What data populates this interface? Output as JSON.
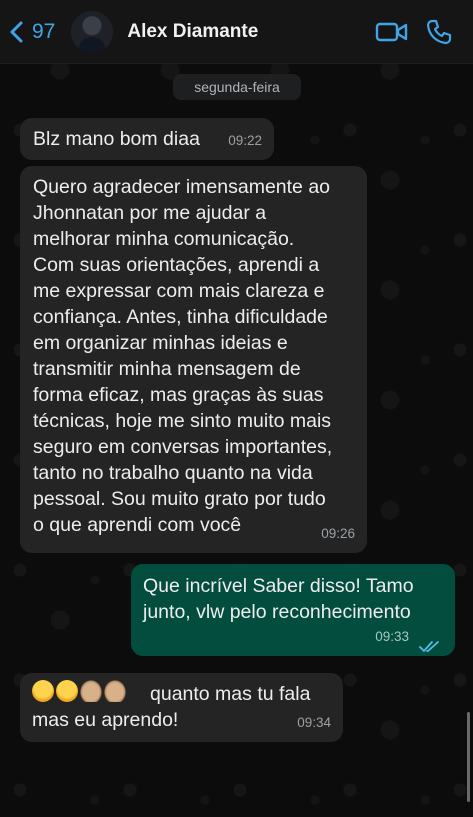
{
  "header": {
    "back_count": "97",
    "contact_name": "Alex Diamante",
    "video_icon": "video-camera-icon",
    "call_icon": "phone-icon",
    "accent": "#3ea6e8"
  },
  "chat": {
    "day_label": "segunda-feira",
    "messages": [
      {
        "direction": "in",
        "text": "Blz mano bom diaa",
        "time": "09:22"
      },
      {
        "direction": "in",
        "text": "Quero agradecer imensamente ao\nJhonnatan por me ajudar a\nmelhorar minha comunicação.\nCom suas orientações, aprendi a\nme expressar com mais clareza e\nconfiança. Antes, tinha dificuldade\nem organizar minhas ideias e\ntransmitir minha mensagem de\nforma eficaz, mas graças às suas\ntécnicas, hoje me sinto muito mais\nseguro em conversas importantes,\ntanto no trabalho quanto na vida\npessoal. Sou muito grato por tudo\no que aprendi com você",
        "time": "09:26"
      },
      {
        "direction": "out",
        "text": "Que incrível Saber disso! Tamo\njunto, vlw pelo reconhecimento",
        "time": "09:33",
        "status": "read"
      },
      {
        "direction": "in",
        "text": "quanto mas tu fala\nmas eu aprendo!",
        "time": "09:34",
        "emojis": [
          "smiling-face-with-hearts",
          "smiling-face-with-hearts",
          "folded-hands",
          "folded-hands"
        ]
      }
    ],
    "outgoing_color": "#034d3f",
    "incoming_color": "#242424",
    "read_tick_color": "#53bdeb"
  }
}
